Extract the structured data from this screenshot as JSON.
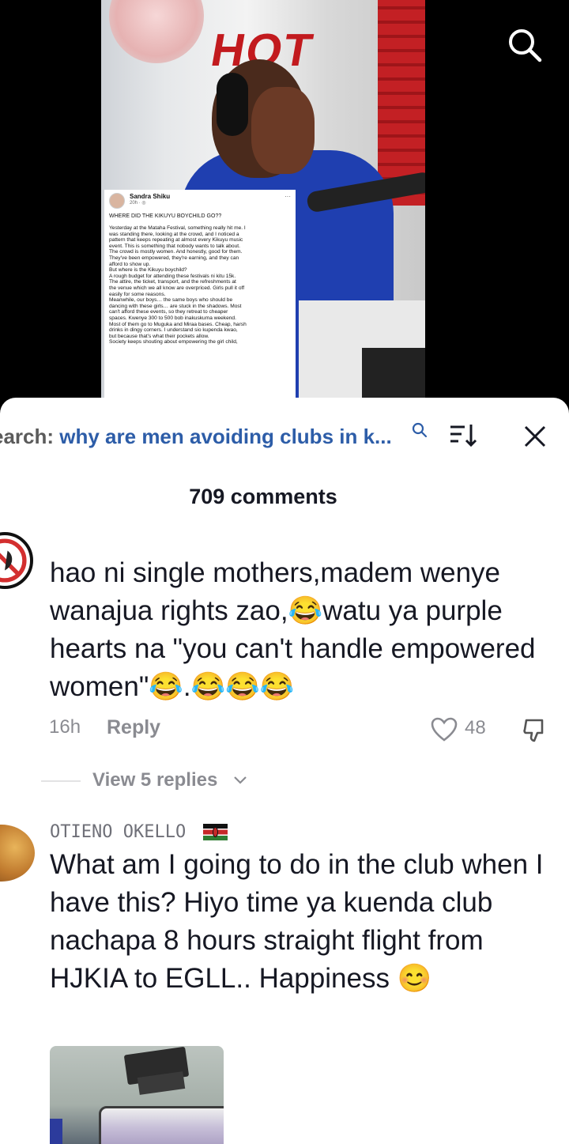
{
  "video": {
    "post": {
      "author": "Sandra Shiku",
      "time": "20h · ",
      "menu": "···",
      "title": "WHERE DID THE KIKUYU BOYCHILD GO??",
      "body": "Yesterday at the Mataha Festival, something really hit me. I\nwas standing there, looking at the crowd, and I noticed a\npattern that keeps repeating at almost every Kikuyu music\nevent. This is something that nobody wants to talk about.\nThe crowd is mostly women. And honestly, good for them.\nThey've been empowered, they're earning, and they can\nafford to show up.\nBut where is the Kikuyu boychild?\nA rough budget for attending these festivals ni kitu 15k.\nThe attire, the ticket, transport, and the refreshments at\nthe venue which we all know are overpriced. Girls pull it off\neasily for some reasons.\nMeanwhile, our boys… the same boys who should be\ndancing with these girls… are stuck in the shadows. Most\ncan't afford these events, so they retreat to cheaper\nspaces. Kwenye 300 to 500 bob inakuskuma weekend.\nMost of them go to Muguka and Miraa bases. Cheap, harsh\ndrinks in dingy corners. I understand sio kupenda kwao,\nbut because that's what their pockets allow.\nSociety keeps shouting about empowering the girl child,"
    },
    "sign_text": "HOT",
    "search_icon": "search-icon"
  },
  "search": {
    "prefix": "earch: ",
    "query": "why are men avoiding clubs in k..."
  },
  "comments_count": "709 comments",
  "comments": [
    {
      "text": "hao ni single mothers,madem wenye wanajua rights zao,😂watu ya purple hearts na \"you can't handle empowered women\"😂.😂😂😂",
      "time": "16h",
      "reply_label": "Reply",
      "likes": "48",
      "view_replies": "View 5 replies"
    },
    {
      "username": "OTIENO OKELLO",
      "text": "What am I going to do in the club when I have this? Hiyo time ya kuenda club nachapa 8 hours straight flight from HJKIA to EGLL.. Happiness 😊"
    }
  ],
  "colors": {
    "query_blue": "#2d5da8",
    "meta_gray": "#8a8b91",
    "text_dark": "#161823"
  }
}
